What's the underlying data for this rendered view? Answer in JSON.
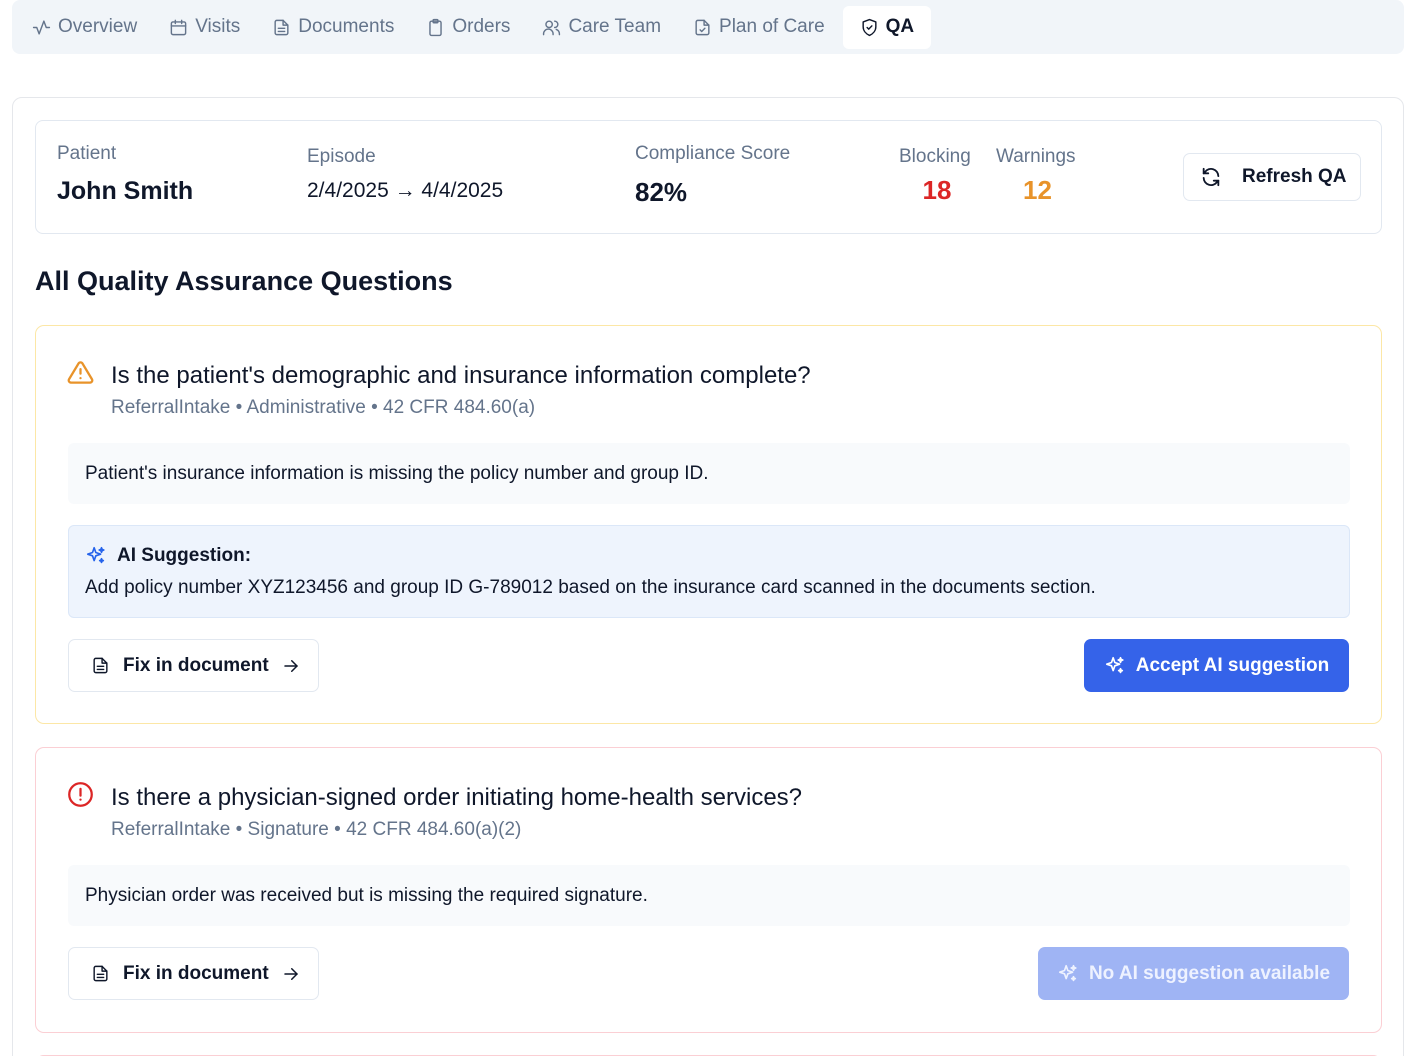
{
  "tabs": [
    {
      "label": "Overview",
      "icon": "activity-icon"
    },
    {
      "label": "Visits",
      "icon": "calendar-icon"
    },
    {
      "label": "Documents",
      "icon": "file-text-icon"
    },
    {
      "label": "Orders",
      "icon": "clipboard-icon"
    },
    {
      "label": "Care Team",
      "icon": "users-icon"
    },
    {
      "label": "Plan of Care",
      "icon": "file-check-icon"
    },
    {
      "label": "QA",
      "icon": "shield-check-icon",
      "active": true
    }
  ],
  "summary": {
    "patient_label": "Patient",
    "patient_name": "John Smith",
    "episode_label": "Episode",
    "episode_range": "2/4/2025 → 4/4/2025",
    "compliance_label": "Compliance Score",
    "compliance_value": "82%",
    "blocking_label": "Blocking",
    "blocking_value": "18",
    "warnings_label": "Warnings",
    "warnings_value": "12",
    "refresh_label": "Refresh QA"
  },
  "section_title": "All Quality Assurance Questions",
  "questions": [
    {
      "severity": "warning",
      "icon": "alert-triangle-icon",
      "title": "Is the patient's demographic and insurance information complete?",
      "meta": "ReferralIntake • Administrative • 42 CFR 484.60(a)",
      "finding": "Patient's insurance information is missing the policy number and group ID.",
      "ai_label": "AI Suggestion:",
      "ai_text": "Add policy number XYZ123456 and group ID G-789012 based on the insurance card scanned in the documents section.",
      "fix_label": "Fix in document",
      "accept_label": "Accept AI suggestion"
    },
    {
      "severity": "blocking",
      "icon": "alert-circle-icon",
      "title": "Is there a physician-signed order initiating home-health services?",
      "meta": "ReferralIntake • Signature • 42 CFR 484.60(a)(2)",
      "finding": "Physician order was received but is missing the required signature.",
      "fix_label": "Fix in document",
      "accept_label": "No AI suggestion available"
    }
  ],
  "colors": {
    "blocking": "#dc2626",
    "warning": "#e8932a",
    "primary": "#3563e9",
    "primary_disabled": "#9fb4f4"
  }
}
